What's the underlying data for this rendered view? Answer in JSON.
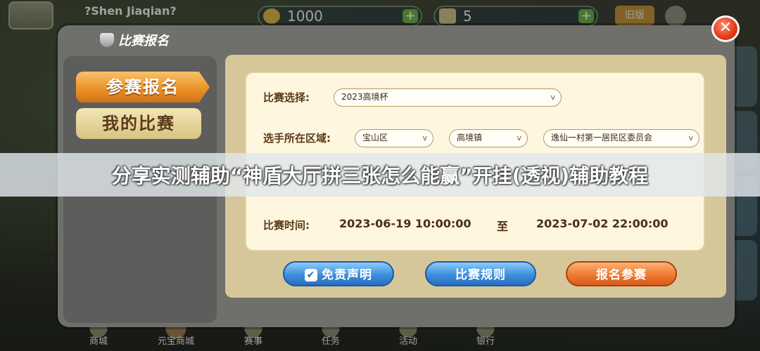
{
  "topbar": {
    "player_name": "?Shen Jiaqian?",
    "coins": "1000",
    "tickets": "5",
    "old_version_label": "旧版"
  },
  "modal": {
    "title": "比赛报名",
    "menu": {
      "signup_label": "参赛报名",
      "my_matches_label": "我的比赛"
    },
    "form": {
      "match_select_label": "比赛选择:",
      "match_selected": "2023高境杯",
      "region_label": "选手所在区域:",
      "district_selected": "宝山区",
      "town_selected": "高境镇",
      "community_selected": "逸仙一村第一居民区委员会",
      "time_label": "比赛时间:",
      "start_time": "2023-06-19 10:00:00",
      "to_label": "至",
      "end_time": "2023-07-02 22:00:00"
    },
    "buttons": {
      "disclaimer_label": "免责声明",
      "rules_label": "比赛规则",
      "register_label": "报名参赛"
    },
    "close_label": "✕"
  },
  "bottom_nav": [
    "商城",
    "元宝商城",
    "赛事",
    "任务",
    "活动",
    "银行"
  ],
  "banner": {
    "text": "分享实测辅助“神盾大厅拼三张怎么能赢”开挂(透视)辅助教程"
  }
}
